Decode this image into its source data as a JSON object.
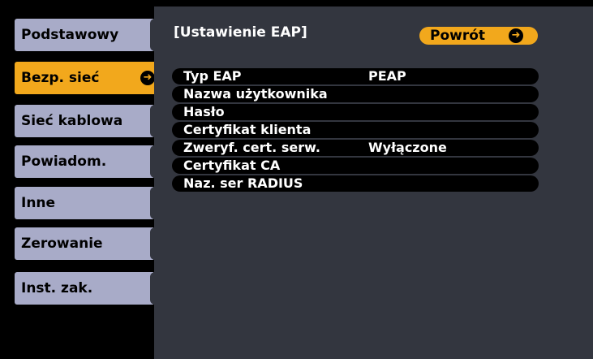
{
  "sidebar": {
    "items": [
      {
        "label": "Podstawowy"
      },
      {
        "label": "Bezp. sieć",
        "selected": true
      },
      {
        "label": "Sieć kablowa"
      },
      {
        "label": "Powiadom."
      },
      {
        "label": "Inne"
      },
      {
        "label": "Zerowanie"
      },
      {
        "label": "Inst. zak."
      }
    ]
  },
  "panel": {
    "title": "[Ustawienie EAP]",
    "back_label": "Powrót",
    "rows": [
      {
        "label": "Typ EAP",
        "value": "PEAP"
      },
      {
        "label": "Nazwa użytkownika",
        "value": ""
      },
      {
        "label": "Hasło",
        "value": ""
      },
      {
        "label": "Certyfikat klienta",
        "value": ""
      },
      {
        "label": "Zweryf. cert. serw.",
        "value": "Wyłączone"
      },
      {
        "label": "Certyfikat CA",
        "value": ""
      },
      {
        "label": "Naz. ser RADIUS",
        "value": ""
      }
    ]
  },
  "colors": {
    "accent": "#f2a81c",
    "tab": "#a8abc8",
    "panel": "#33363f"
  },
  "icons": {
    "enter": "enter-icon"
  }
}
